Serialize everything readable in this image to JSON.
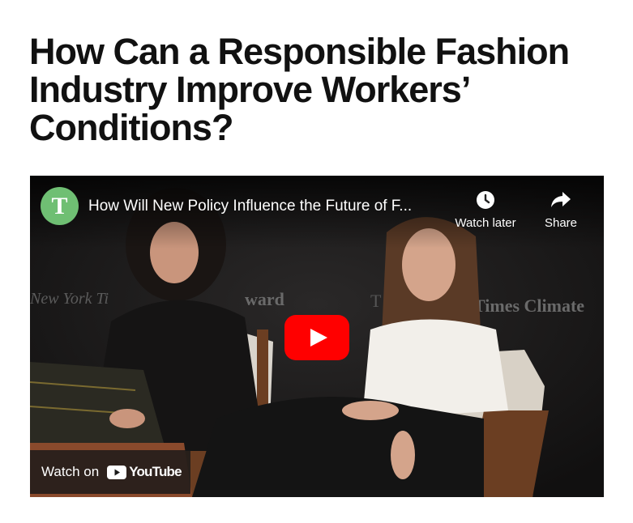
{
  "article": {
    "headline": "How Can a Responsible Fashion Industry Improve Workers’ Conditions?"
  },
  "video": {
    "channel_logo_letter": "T",
    "title": "How Will New Policy Influence the Future of F...",
    "watch_later_label": "Watch later",
    "share_label": "Share",
    "watch_on_label": "Watch on",
    "youtube_wordmark": "YouTube",
    "stage_backdrop_text_left": "New York Ti",
    "stage_backdrop_text_mid": "ward",
    "stage_backdrop_text_right": "Times Climate",
    "stage_backdrop_text_right_initial": "T"
  },
  "colors": {
    "play_red": "#ff0000",
    "logo_green": "#6fbf73",
    "headline": "#111111"
  },
  "icons": {
    "watch_later": "clock-icon",
    "share": "share-arrow-icon",
    "play": "play-icon",
    "youtube": "youtube-logo-icon"
  }
}
